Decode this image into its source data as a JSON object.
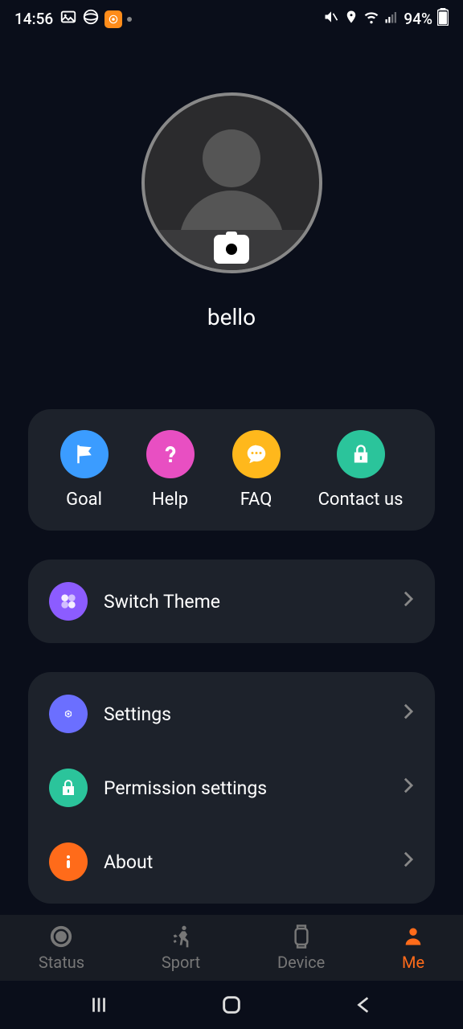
{
  "status": {
    "time": "14:56",
    "battery": "94%"
  },
  "profile": {
    "username": "bello"
  },
  "quick": {
    "goal": "Goal",
    "help": "Help",
    "faq": "FAQ",
    "contact": "Contact us"
  },
  "list": {
    "theme": "Switch Theme",
    "settings": "Settings",
    "permissions": "Permission settings",
    "about": "About"
  },
  "nav": {
    "status": "Status",
    "sport": "Sport",
    "device": "Device",
    "me": "Me"
  }
}
